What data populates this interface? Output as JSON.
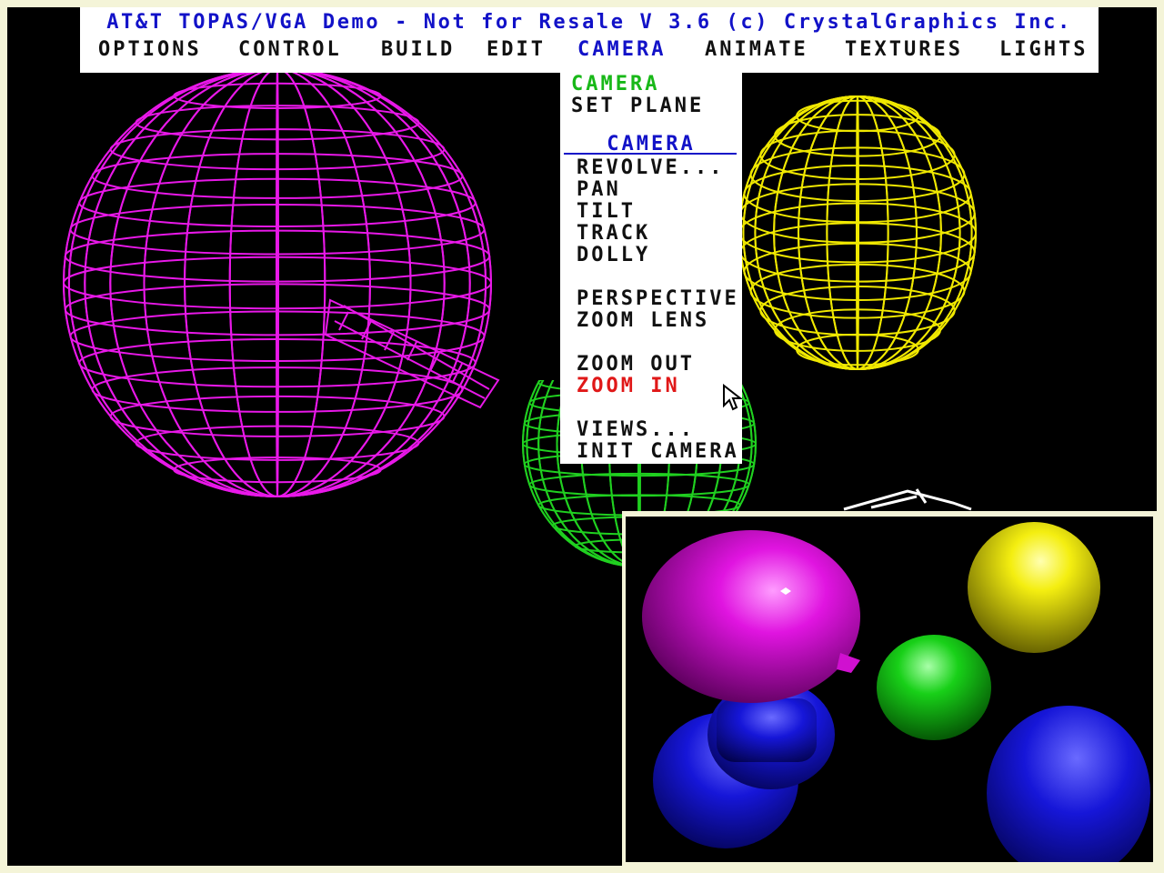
{
  "window": {
    "title": "AT&T TOPAS/VGA Demo - Not for Resale V 3.6  (c) CrystalGraphics  Inc."
  },
  "menubar": {
    "items": [
      {
        "label": "OPTIONS"
      },
      {
        "label": "CONTROL"
      },
      {
        "label": "BUILD"
      },
      {
        "label": "EDIT"
      },
      {
        "label": "CAMERA",
        "active": true
      },
      {
        "label": "ANIMATE"
      },
      {
        "label": "TEXTURES"
      },
      {
        "label": "LIGHTS"
      }
    ]
  },
  "camera_menu": {
    "header": "CAMERA",
    "set_plane": "SET PLANE",
    "section_title": "CAMERA",
    "items": [
      {
        "label": "REVOLVE..."
      },
      {
        "label": "PAN"
      },
      {
        "label": "TILT"
      },
      {
        "label": "TRACK"
      },
      {
        "label": "DOLLY"
      },
      {
        "label": "PERSPECTIVE"
      },
      {
        "label": "ZOOM LENS"
      },
      {
        "label": "ZOOM OUT"
      },
      {
        "label": "ZOOM IN",
        "highlighted": true
      },
      {
        "label": "VIEWS..."
      },
      {
        "label": "INIT CAMERA"
      }
    ]
  },
  "colors": {
    "title_blue": "#1212c8",
    "header_green": "#18b818",
    "highlight_red": "#e01818",
    "wire_magenta": "#e818e8",
    "wire_yellow": "#f0e800",
    "wire_green": "#20d020"
  }
}
